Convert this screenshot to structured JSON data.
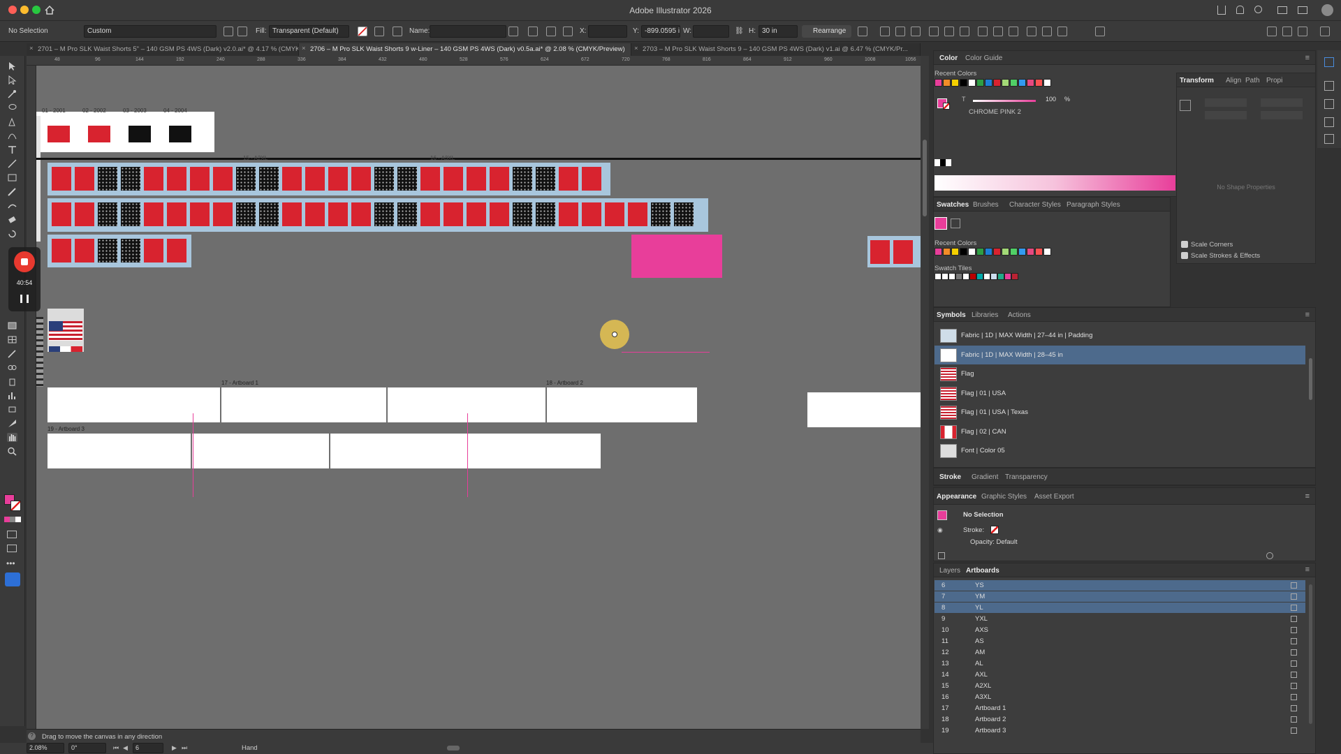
{
  "app": {
    "title": "Adobe Illustrator 2026"
  },
  "control_bar": {
    "selection": "No Selection",
    "preset": "Custom",
    "fill_label": "Fill:",
    "fill_value": "Transparent (Default)",
    "name_label": "Name:",
    "x_label": "X:",
    "y_label": "Y:",
    "y_value": "-899.0595 i",
    "w_label": "W:",
    "h_label": "H:",
    "h_value": "30 in",
    "rearrange_label": "Rearrange"
  },
  "doc_tabs": [
    {
      "label": "2701 – M Pro SLK Waist Shorts 5\" – 140 GSM PS 4WS (Dark) v2.0.ai* @ 4.17 % (CMYK...",
      "active": false
    },
    {
      "label": "2706 – M Pro SLK Waist Shorts 9 w-Liner – 140 GSM PS 4WS (Dark) v0.5a.ai* @ 2.08 % (CMYK/Preview)",
      "active": true
    },
    {
      "label": "2703 – M Pro SLK Waist Shorts 9 – 140 GSM PS 4WS (Dark) v1.ai @ 6.47 % (CMYK/Pr...",
      "active": false
    }
  ],
  "ruler_top_ticks": [
    "48",
    "96",
    "144",
    "192",
    "240",
    "288",
    "336",
    "384",
    "432",
    "480",
    "528",
    "576",
    "624",
    "672",
    "720",
    "768",
    "816",
    "864",
    "912",
    "960",
    "1008",
    "1056"
  ],
  "recording": {
    "timer": "40:54"
  },
  "canvas": {
    "artboard_labels": {
      "a17": "17 - Artboard 1",
      "a18": "18 - Artboard 2",
      "a19": "19 - Artboard 3",
      "label_axl": "15 - A2XL",
      "label_a3xl": "16 - A3XL"
    },
    "header_labels": [
      "01 - 2001",
      "02 - 2002",
      "03 - 2003",
      "04 - 2004"
    ]
  },
  "status": {
    "hint": "Drag to move the canvas in any direction",
    "zoom": "2.08%",
    "rotation": "0°",
    "artboard_num": "6",
    "tool": "Hand"
  },
  "color_panel": {
    "tabs": [
      "Color",
      "Color Guide"
    ],
    "recent_colors_label": "Recent Colors",
    "tint_value": "100",
    "tint_unit": "%",
    "swatch_name": "CHROME PINK 2",
    "colors": {
      "pink": "#e83e9a",
      "red": "#d8232f",
      "panel_bg": "#3d3d3d"
    }
  },
  "swatches_panel": {
    "tabs": [
      "Swatches",
      "Brushes",
      "Character Styles",
      "Paragraph Styles"
    ],
    "recent_colors_label": "Recent Colors",
    "swatch_tiles_label": "Swatch Tiles"
  },
  "transform_panel": {
    "tabs": [
      "Transform",
      "Align",
      "Path",
      "Propi"
    ],
    "empty_text": "No Shape Properties",
    "scale_corners": "Scale Corners",
    "scale_strokes": "Scale Strokes & Effects"
  },
  "symbols_panel": {
    "tabs": [
      "Symbols",
      "Libraries",
      "Actions"
    ],
    "items": [
      {
        "name": "Fabric | 1D | MAX Width | 27–44 in | Padding",
        "thumb": "fabric",
        "selected": false
      },
      {
        "name": "Fabric | 1D | MAX Width | 28–45 in",
        "thumb": "blank",
        "selected": true
      },
      {
        "name": "Flag",
        "thumb": "us-flag",
        "selected": false
      },
      {
        "name": "Flag | 01 | USA",
        "thumb": "us-flag",
        "selected": false
      },
      {
        "name": "Flag | 01 | USA | Texas",
        "thumb": "tx-flag",
        "selected": false
      },
      {
        "name": "Flag | 02 | CAN",
        "thumb": "ca-flag",
        "selected": false
      },
      {
        "name": "Font | Color 05",
        "thumb": "font",
        "selected": false
      }
    ]
  },
  "stroke_panel": {
    "tabs": [
      "Stroke",
      "Gradient",
      "Transparency"
    ]
  },
  "appearance_panel": {
    "tabs": [
      "Appearance",
      "Graphic Styles",
      "Asset Export"
    ],
    "title": "No Selection",
    "stroke_label": "Stroke:",
    "opacity_label": "Opacity: Default"
  },
  "artboards_panel": {
    "tabs": [
      "Layers",
      "Artboards"
    ],
    "rows": [
      {
        "num": "6",
        "name": "YS",
        "selected": true
      },
      {
        "num": "7",
        "name": "YM",
        "selected": true
      },
      {
        "num": "8",
        "name": "YL",
        "selected": true
      },
      {
        "num": "9",
        "name": "YXL",
        "selected": false
      },
      {
        "num": "10",
        "name": "AXS",
        "selected": false
      },
      {
        "num": "11",
        "name": "AS",
        "selected": false
      },
      {
        "num": "12",
        "name": "AM",
        "selected": false
      },
      {
        "num": "13",
        "name": "AL",
        "selected": false
      },
      {
        "num": "14",
        "name": "AXL",
        "selected": false
      },
      {
        "num": "15",
        "name": "A2XL",
        "selected": false
      },
      {
        "num": "16",
        "name": "A3XL",
        "selected": false
      },
      {
        "num": "17",
        "name": "Artboard 1",
        "selected": false
      },
      {
        "num": "18",
        "name": "Artboard 2",
        "selected": false
      },
      {
        "num": "19",
        "name": "Artboard 3",
        "selected": false
      }
    ]
  }
}
